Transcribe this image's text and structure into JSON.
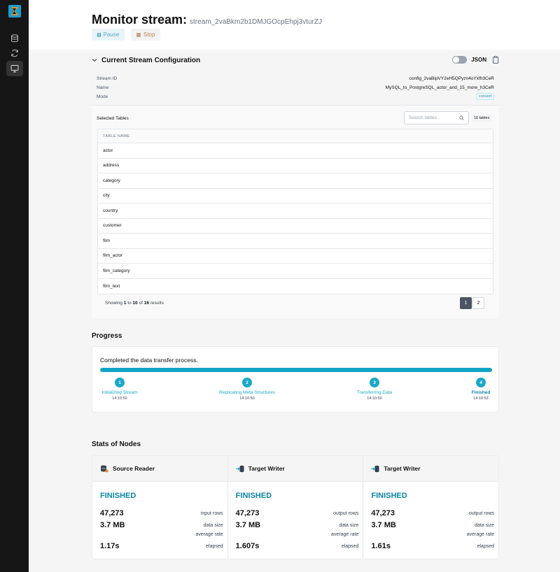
{
  "header": {
    "title": "Monitor stream:",
    "stream_id": "stream_2vaBkm2b1DMJGOcpEhpj3vturZJ",
    "pause_label": "Pause",
    "stop_label": "Stop"
  },
  "config": {
    "section_title": "Current Stream Configuration",
    "json_label": "JSON",
    "rows": [
      {
        "key": "Stream ID",
        "value": "config_2vaBipVY2eH5QPyzn4oYxfh3CeR"
      },
      {
        "key": "Name",
        "value": "MySQL_to_PostgreSQL_actor_and_15_more_h3CeR"
      },
      {
        "key": "Mode",
        "value": "convert"
      }
    ],
    "selected_tables_label": "Selected Tables",
    "search_placeholder": "Search tables...",
    "count_badge": "16 tables",
    "table_header": "TABLE NAME",
    "tables": [
      "actor",
      "address",
      "category",
      "city",
      "country",
      "customer",
      "film",
      "film_actor",
      "film_category",
      "film_text"
    ],
    "pager": {
      "prefix": "Showing",
      "from": "1",
      "to_word": "to",
      "to": "10",
      "of_word": "of",
      "total": "16",
      "suffix": "results"
    },
    "pages": [
      "1",
      "2"
    ]
  },
  "progress": {
    "title": "Progress",
    "message": "Completed the data transfer process.",
    "fraction": 1.0,
    "steps": [
      {
        "num": "1",
        "label": "Initializing Stream",
        "time": "14:10:50"
      },
      {
        "num": "2",
        "label": "Replicating Meta Structures",
        "time": "14:10:50"
      },
      {
        "num": "3",
        "label": "Transferring Data",
        "time": "14:10:53"
      },
      {
        "num": "4",
        "label": "Finished",
        "time": "14:10:53"
      }
    ]
  },
  "stats": {
    "title": "Stats of Nodes",
    "nodes": [
      {
        "name": "Source Reader",
        "status": "FINISHED",
        "rows": "47,273",
        "rows_label": "input rows",
        "size": "3.7 MB",
        "size_label": "data size",
        "rate_label": "average rate",
        "elapsed": "1.17s",
        "elapsed_label": "elapsed"
      },
      {
        "name": "Target Writer",
        "status": "FINISHED",
        "rows": "47,273",
        "rows_label": "output rows",
        "size": "3.7 MB",
        "size_label": "data size",
        "rate_label": "average rate",
        "elapsed": "1.607s",
        "elapsed_label": "elapsed"
      },
      {
        "name": "Target Writer",
        "status": "FINISHED",
        "rows": "47,273",
        "rows_label": "output rows",
        "size": "3.7 MB",
        "size_label": "data size",
        "rate_label": "average rate",
        "elapsed": "1.61s",
        "elapsed_label": "elapsed"
      }
    ]
  },
  "colors": {
    "accent": "#0ea5c6",
    "sidebar": "#161616",
    "status": "#0b86a5"
  }
}
